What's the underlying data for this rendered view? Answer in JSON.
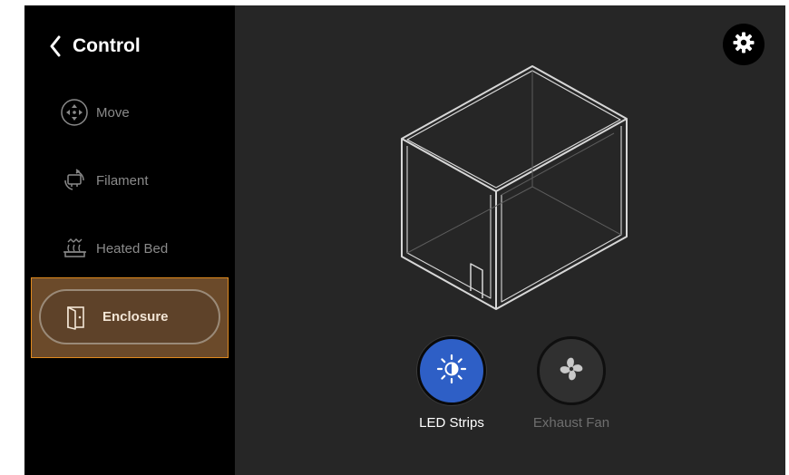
{
  "header": {
    "back_icon": "chevron-left-icon",
    "title": "Control"
  },
  "sidebar": {
    "items": [
      {
        "label": "Move",
        "icon": "move-arrows-icon",
        "active": false
      },
      {
        "label": "Filament",
        "icon": "filament-icon",
        "active": false
      },
      {
        "label": "Heated Bed",
        "icon": "heated-bed-icon",
        "active": false
      },
      {
        "label": "Enclosure",
        "icon": "door-icon",
        "active": true
      }
    ]
  },
  "top_right": {
    "icon": "gear-icon"
  },
  "controls": [
    {
      "label": "LED Strips",
      "icon": "brightness-icon",
      "state": "on"
    },
    {
      "label": "Exhaust Fan",
      "icon": "fan-icon",
      "state": "off"
    }
  ],
  "colors": {
    "background": "#262626",
    "sidebar": "#000000",
    "active_item_fill": "#6b4a2a",
    "active_item_border": "#e08a1e",
    "led_active": "#2e5fc6",
    "text_primary": "#ffffff",
    "text_muted": "#8a8a8a"
  }
}
